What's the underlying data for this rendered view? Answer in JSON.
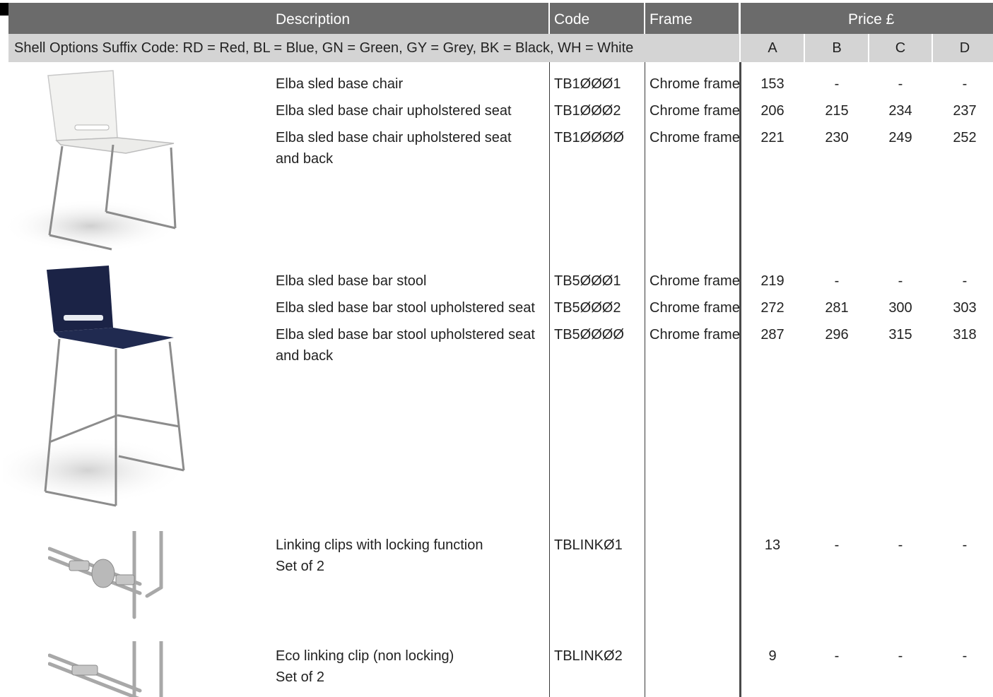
{
  "header": {
    "description": "Description",
    "code": "Code",
    "frame": "Frame",
    "price": "Price £"
  },
  "suffix_row": {
    "text": "Shell Options Suffix Code:  RD = Red, BL = Blue, GN = Green, GY = Grey, BK = Black, WH = White",
    "bands": [
      "A",
      "B",
      "C",
      "D"
    ]
  },
  "groups": [
    {
      "image": "white-chair-image",
      "rows": [
        {
          "desc": "Elba sled base chair",
          "code": "TB1ØØØ1",
          "frame": "Chrome frame",
          "a": "153",
          "b": "-",
          "c": "-",
          "d": "-"
        },
        {
          "desc": "Elba sled base chair upholstered seat",
          "code": "TB1ØØØ2",
          "frame": "Chrome frame",
          "a": "206",
          "b": "215",
          "c": "234",
          "d": "237"
        },
        {
          "desc": "Elba sled base chair upholstered seat and back",
          "code": "TB1ØØØØ",
          "frame": "Chrome frame",
          "a": "221",
          "b": "230",
          "c": "249",
          "d": "252"
        }
      ]
    },
    {
      "image": "navy-bar-stool-image",
      "rows": [
        {
          "desc": "Elba sled base bar stool",
          "code": "TB5ØØØ1",
          "frame": "Chrome frame",
          "a": "219",
          "b": "-",
          "c": "-",
          "d": "-"
        },
        {
          "desc": "Elba sled base bar stool upholstered seat",
          "code": "TB5ØØØ2",
          "frame": "Chrome frame",
          "a": "272",
          "b": "281",
          "c": "300",
          "d": "303"
        },
        {
          "desc": "Elba sled base bar stool upholstered seat and back",
          "code": "TB5ØØØØ",
          "frame": "Chrome frame",
          "a": "287",
          "b": "296",
          "c": "315",
          "d": "318"
        }
      ]
    },
    {
      "image": "linking-clip-image",
      "rows": [
        {
          "desc": "Linking clips with locking function",
          "desc2": "Set of 2",
          "code": "TBLINKØ1",
          "frame": "",
          "a": "13",
          "b": "-",
          "c": "-",
          "d": "-"
        }
      ]
    },
    {
      "image": "eco-clip-image",
      "rows": [
        {
          "desc": "Eco linking clip (non locking)",
          "desc2": "Set of 2",
          "code": "TBLINKØ2",
          "frame": "",
          "a": "9",
          "b": "-",
          "c": "-",
          "d": "-"
        }
      ]
    }
  ],
  "colors": {
    "header_bg": "#6b6b6b",
    "suffix_bg": "#d4d4d4",
    "shell_white": "#f0f0ee",
    "shell_navy": "#1b2346",
    "chrome": "#8c8c8c"
  }
}
